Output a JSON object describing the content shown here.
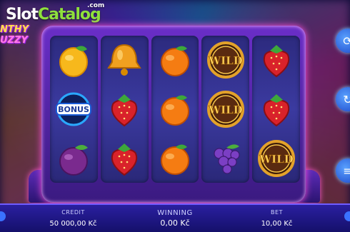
{
  "site_logo": {
    "slot": "Slot",
    "catalog": "Catalog",
    "com": ".com"
  },
  "game_logo": {
    "line1": "NTHY",
    "line2": "UZZY"
  },
  "reels": [
    [
      "lemon",
      "bonus",
      "plum"
    ],
    [
      "bell",
      "strawberry",
      "strawberry"
    ],
    [
      "orange",
      "orange",
      "orange"
    ],
    [
      "wild",
      "wild",
      "grapes"
    ],
    [
      "strawberry",
      "strawberry",
      "wild"
    ]
  ],
  "symbol_text": {
    "wild": "WILD",
    "bonus": "BONUS"
  },
  "bottom_bar": {
    "credit_label": "CREDIT",
    "credit_value": "50 000,00 Kč",
    "winning_label": "WINNING",
    "winning_value": "0,00 Kč",
    "bet_label": "BET",
    "bet_value": "10,00 Kč"
  },
  "side_buttons": [
    "spin-button",
    "autoplay-button",
    "bet-button"
  ],
  "colors": {
    "accent": "#ff4fd8",
    "bar": "#15106a",
    "logo_green": "#8ee03c"
  }
}
